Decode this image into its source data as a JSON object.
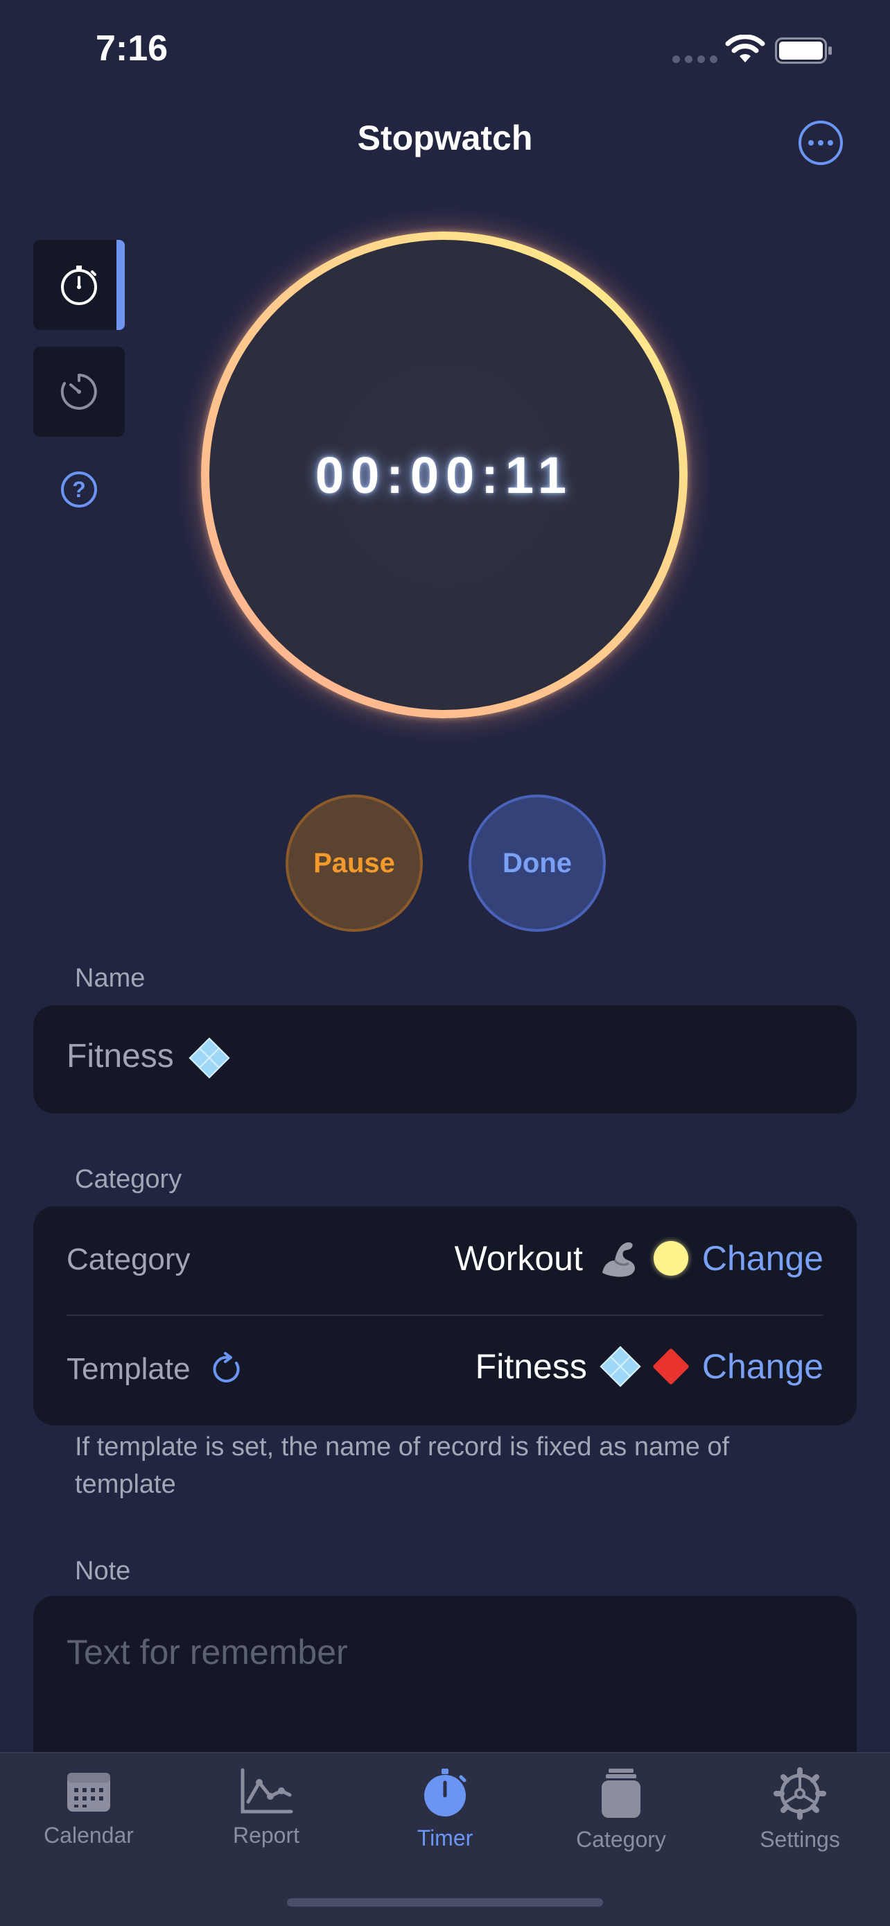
{
  "status": {
    "time": "7:16"
  },
  "header": {
    "title": "Stopwatch"
  },
  "timer": {
    "display": "00:00:11"
  },
  "controls": {
    "pause_label": "Pause",
    "done_label": "Done"
  },
  "name_section": {
    "label": "Name",
    "value": "Fitness"
  },
  "category_section": {
    "label": "Category",
    "rows": [
      {
        "label": "Category",
        "value": "Workout",
        "icon": "flexed-biceps-emoji",
        "color": "#fff38e",
        "action": "Change"
      },
      {
        "label": "Template",
        "value": "Fitness",
        "icon": "diamonds-emoji",
        "color": "#e8332e",
        "action": "Change"
      }
    ],
    "caption": "If template is set, the name of record is fixed as name of template"
  },
  "note_section": {
    "label": "Note",
    "placeholder": "Text for remember"
  },
  "tabs": [
    {
      "label": "Calendar",
      "icon": "calendar-icon"
    },
    {
      "label": "Report",
      "icon": "report-chart-icon"
    },
    {
      "label": "Timer",
      "icon": "timer-icon",
      "active": true
    },
    {
      "label": "Category",
      "icon": "category-jar-icon"
    },
    {
      "label": "Settings",
      "icon": "settings-gear-icon"
    }
  ],
  "colors": {
    "background": "#212540",
    "accent": "#6b95f2",
    "pause": "#f39a2c"
  }
}
